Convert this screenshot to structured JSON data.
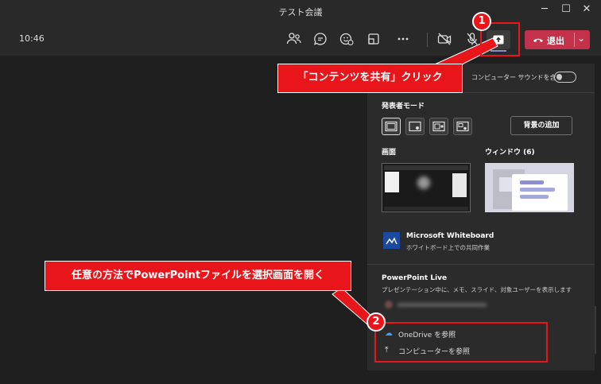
{
  "window": {
    "title": "テスト会議",
    "controls": [
      "─",
      "☐",
      "✕"
    ]
  },
  "toolbar": {
    "time": "10:46",
    "icons": [
      "people-icon",
      "chat-icon",
      "reactions-icon",
      "rooms-icon",
      "more-icon",
      "camera-off-icon",
      "mic-icon",
      "share-icon"
    ],
    "leave_label": "退出",
    "leave_color": "#c4314b"
  },
  "share_panel": {
    "computer_sound_label": "コンピューター サウンドを含む",
    "computer_sound_on": false,
    "presenter_mode_title": "発表者モード",
    "background_button": "背景の追加",
    "screen_title": "画面",
    "window_title": "ウィンドウ (6)",
    "whiteboard_title": "Microsoft Whiteboard",
    "whiteboard_sub": "ホワイトボード上での共同作業",
    "powerpoint_title": "PowerPoint Live",
    "powerpoint_sub": "プレゼンテーション中に、メモ、スライド、対象ユーザーを表示します",
    "browse_onedrive": "OneDrive を参照",
    "browse_computer": "コンピューターを参照"
  },
  "annotations": {
    "callout1": "「コンテンツを共有」クリック",
    "callout2": "任意の方法でPowerPointファイルを選択画面を開く",
    "badge1": "1",
    "badge2": "2",
    "accent_color": "#e8161b"
  }
}
